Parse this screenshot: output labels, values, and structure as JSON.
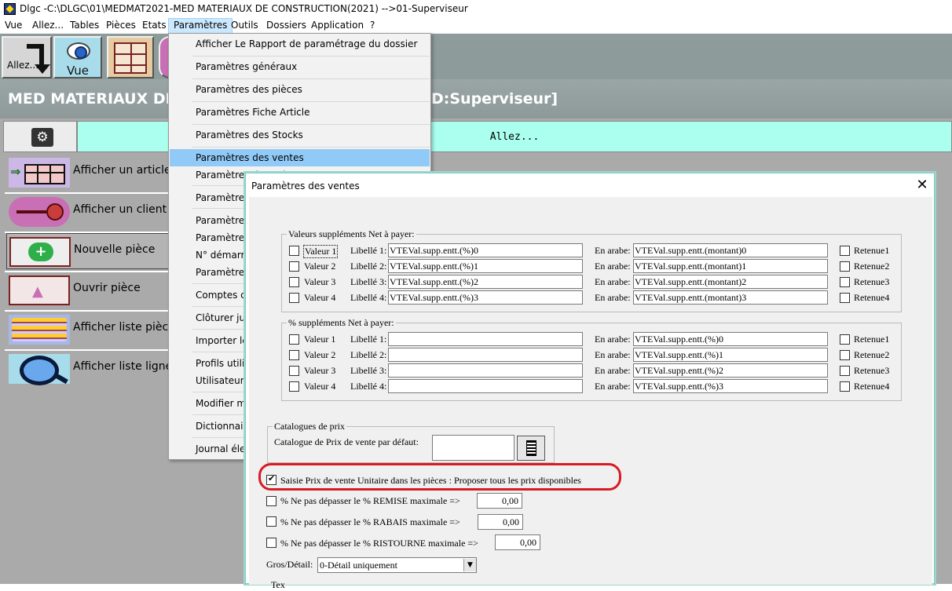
{
  "window": {
    "title": "Dlgc -C:\\DLGC\\01\\MEDMAT2021-MED MATERIAUX DE CONSTRUCTION(2021) -->01-Superviseur"
  },
  "menubar": [
    {
      "label": "Vue"
    },
    {
      "label": "Allez..."
    },
    {
      "label": "Tables"
    },
    {
      "label": "Pièces"
    },
    {
      "label": "Etats"
    },
    {
      "label": "Paramètres",
      "active": true
    },
    {
      "label": "Outils"
    },
    {
      "label": "Dossiers"
    },
    {
      "label": "Application"
    },
    {
      "label": "?"
    }
  ],
  "toolbar": {
    "allez_label": "Allez...",
    "vue_label": "Vue"
  },
  "banner": {
    "title_left": "MED MATERIAUX DE",
    "title_right": "D:Superviseur]"
  },
  "main": {
    "allez_bar": "Allez...",
    "nav": [
      {
        "label": "Afficher un article",
        "icon": "article-grid-icon"
      },
      {
        "label": "Afficher un client",
        "icon": "client-icon"
      },
      {
        "label": "Nouvelle pièce",
        "icon": "add-icon"
      },
      {
        "label": "Ouvrir pièce",
        "icon": "open-icon"
      },
      {
        "label": "Afficher liste pièces",
        "icon": "list-icon"
      },
      {
        "label": "Afficher liste lignes",
        "icon": "magnifier-icon"
      }
    ]
  },
  "dropdown": {
    "items": [
      {
        "label": "Afficher Le Rapport de paramétrage du dossier"
      },
      {
        "label": "Paramètres généraux"
      },
      {
        "label": "Paramètres des pièces"
      },
      {
        "label": "Paramètres Fiche Article"
      },
      {
        "label": "Paramètres des Stocks"
      },
      {
        "label": "Paramètres des ventes",
        "highlighted": true
      },
      {
        "label": "Paramètres des achats"
      },
      {
        "label": "Paramètres"
      },
      {
        "label": "Paramètres"
      },
      {
        "label": "Paramètres"
      },
      {
        "label": "N° démarra"
      },
      {
        "label": "Paramètres"
      },
      {
        "label": "Comptes co"
      },
      {
        "label": "Clôturer jus"
      },
      {
        "label": "Importer les"
      },
      {
        "label": "Profils utilis"
      },
      {
        "label": "Utilisateurs"
      },
      {
        "label": "Modifier mo"
      },
      {
        "label": "Dictionnaire"
      },
      {
        "label": "Journal élec"
      }
    ]
  },
  "dialog": {
    "title": "Paramètres des ventes",
    "close_glyph": "✕",
    "valeurs_group": {
      "title": "Valeurs suppléments Net à payer:",
      "rows": [
        {
          "valeur": "Valeur 1",
          "libelle": "Libellé 1:",
          "libelle_value": "VTEVal.supp.entt.(%)0",
          "arabe": "En arabe:",
          "arabe_value": "VTEVal.supp.entt.(montant)0",
          "retenue": "Retenue1"
        },
        {
          "valeur": "Valeur 2",
          "libelle": "Libellé 2:",
          "libelle_value": "VTEVal.supp.entt.(%)1",
          "arabe": "En arabe:",
          "arabe_value": "VTEVal.supp.entt.(montant)1",
          "retenue": "Retenue2"
        },
        {
          "valeur": "Valeur 3",
          "libelle": "Libellé 3:",
          "libelle_value": "VTEVal.supp.entt.(%)2",
          "arabe": "En arabe:",
          "arabe_value": "VTEVal.supp.entt.(montant)2",
          "retenue": "Retenue3"
        },
        {
          "valeur": "Valeur 4",
          "libelle": "Libellé 4:",
          "libelle_value": "VTEVal.supp.entt.(%)3",
          "arabe": "En arabe:",
          "arabe_value": "VTEVal.supp.entt.(montant)3",
          "retenue": "Retenue4"
        }
      ]
    },
    "pct_group": {
      "title": "% suppléments Net à payer:",
      "rows": [
        {
          "valeur": "Valeur 1",
          "libelle": "Libellé 1:",
          "libelle_value": "",
          "arabe": "En arabe:",
          "arabe_value": "VTEVal.supp.entt.(%)0",
          "retenue": "Retenue1"
        },
        {
          "valeur": "Valeur 2",
          "libelle": "Libellé 2:",
          "libelle_value": "",
          "arabe": "En arabe:",
          "arabe_value": "VTEVal.supp.entt.(%)1",
          "retenue": "Retenue2"
        },
        {
          "valeur": "Valeur 3",
          "libelle": "Libellé 3:",
          "libelle_value": "",
          "arabe": "En arabe:",
          "arabe_value": "VTEVal.supp.entt.(%)2",
          "retenue": "Retenue3"
        },
        {
          "valeur": "Valeur 4",
          "libelle": "Libellé 4:",
          "libelle_value": "",
          "arabe": "En arabe:",
          "arabe_value": "VTEVal.supp.entt.(%)3",
          "retenue": "Retenue4"
        }
      ]
    },
    "catalogues": {
      "title": "Catalogues de prix",
      "label": "Catalogue de Prix de vente par défaut:",
      "value": ""
    },
    "saisie_prix": {
      "label": "Saisie Prix de vente Unitaire dans les pièces : Proposer tous les prix disponibles",
      "checked": true
    },
    "remise": {
      "label": "% Ne pas dépasser le % REMISE maximale =>",
      "value": "0,00",
      "checked": false
    },
    "rabais": {
      "label": "% Ne pas dépasser le % RABAIS maximale =>",
      "value": "0,00",
      "checked": false
    },
    "ristourne": {
      "label": "% Ne pas dépasser le % RISTOURNE maximale =>",
      "value": "0,00",
      "checked": false
    },
    "gros_detail": {
      "label": "Gros/Détail:",
      "value": "0-Détail uniquement"
    },
    "partial_label": "Tex"
  },
  "colors": {
    "accent_highlight": "#91c9f7",
    "annotation_red": "#d81b23",
    "allez_bar": "#aaffee"
  }
}
